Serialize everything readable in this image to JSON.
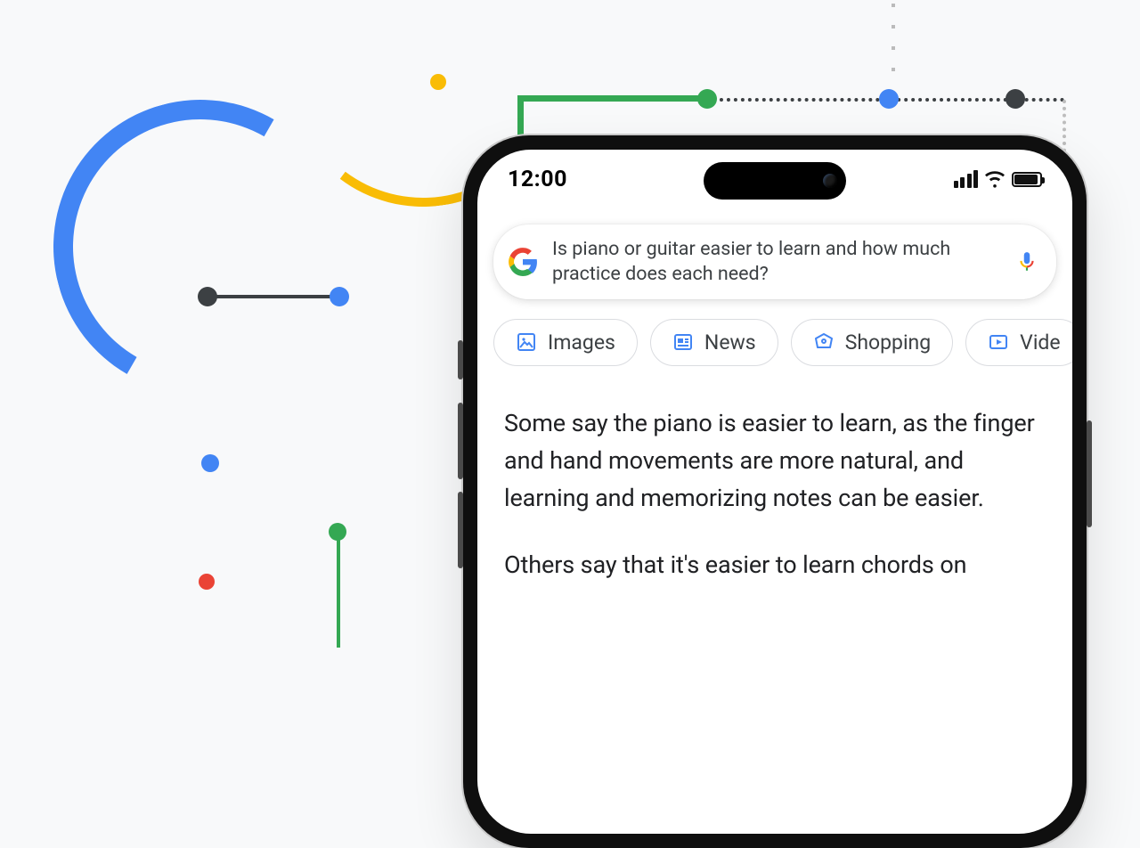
{
  "status": {
    "time": "12:00"
  },
  "search": {
    "query": "Is piano or guitar easier to learn and how much practice does each need?"
  },
  "chips": [
    {
      "label": "Images"
    },
    {
      "label": "News"
    },
    {
      "label": "Shopping"
    },
    {
      "label": "Vide"
    }
  ],
  "result": {
    "p1": "Some say the piano is easier to learn, as the finger and hand movements are more natural, and learning and memorizing notes can be easier.",
    "p2": "Others say that it's easier to learn chords on"
  },
  "colors": {
    "blue": "#4285f4",
    "red": "#ea4335",
    "yellow": "#f9bc05",
    "green": "#34a853",
    "grey": "#3c4043"
  }
}
